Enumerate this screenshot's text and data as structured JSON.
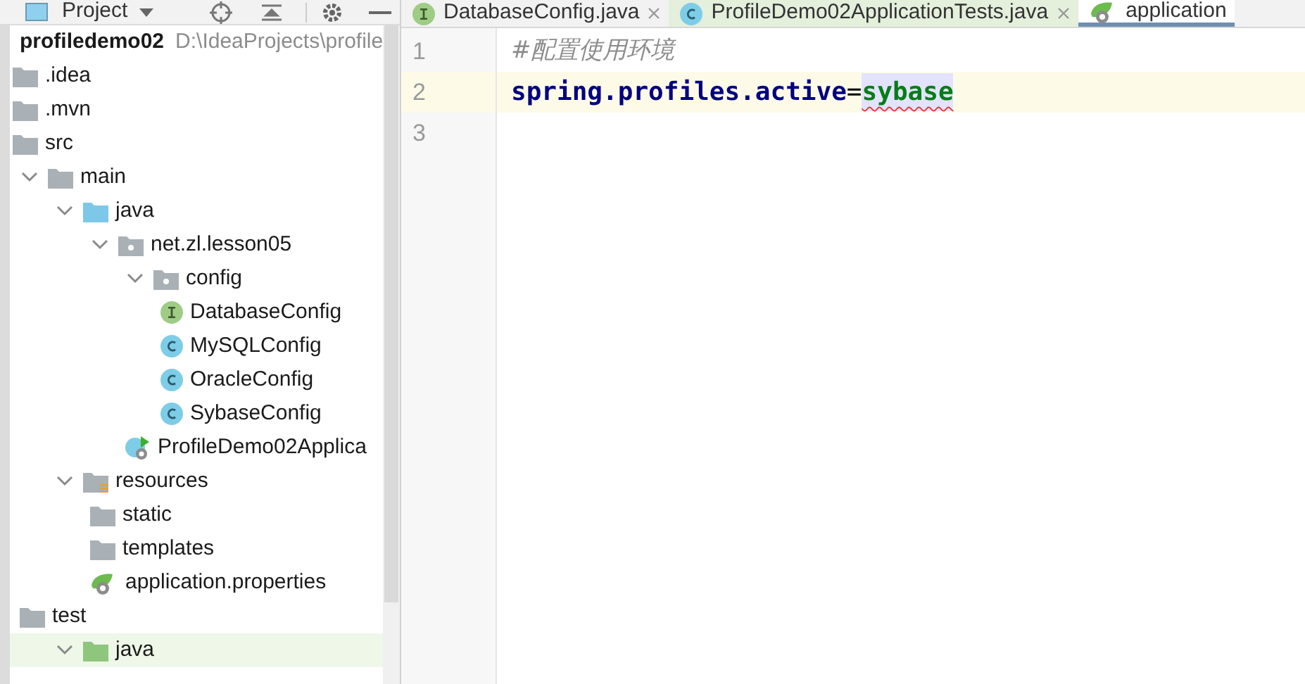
{
  "project_panel": {
    "title": "Project"
  },
  "tree": [
    {
      "name": "profiledemo02",
      "path": "D:\\IdeaProjects\\profile",
      "selected": false,
      "children": [
        {
          "name": ".idea",
          "kind": "folder",
          "selected": false
        },
        {
          "name": ".mvn",
          "kind": "folder",
          "selected": false
        },
        {
          "name": "src",
          "kind": "folder",
          "selected": false,
          "children": [
            {
              "name": "main",
              "kind": "folder",
              "expanded": true,
              "selected": false,
              "children": [
                {
                  "name": "java",
                  "kind": "source-folder",
                  "expanded": true,
                  "selected": false,
                  "children": [
                    {
                      "name": "net.zl.lesson05",
                      "kind": "package",
                      "expanded": true,
                      "selected": false,
                      "children": [
                        {
                          "name": "config",
                          "kind": "package",
                          "expanded": true,
                          "selected": false,
                          "children": [
                            {
                              "name": "DatabaseConfig",
                              "kind": "interface",
                              "selected": false
                            },
                            {
                              "name": "MySQLConfig",
                              "kind": "class",
                              "selected": false
                            },
                            {
                              "name": "OracleConfig",
                              "kind": "class",
                              "selected": false
                            },
                            {
                              "name": "SybaseConfig",
                              "kind": "class",
                              "selected": false
                            }
                          ]
                        },
                        {
                          "name": "ProfileDemo02Applica",
                          "kind": "spring-app",
                          "selected": false
                        }
                      ]
                    }
                  ]
                },
                {
                  "name": "resources",
                  "kind": "resources-folder",
                  "expanded": true,
                  "selected": false,
                  "children": [
                    {
                      "name": "static",
                      "kind": "folder",
                      "selected": false
                    },
                    {
                      "name": "templates",
                      "kind": "folder",
                      "selected": false
                    },
                    {
                      "name": "application.properties",
                      "kind": "spring-properties",
                      "selected": false
                    }
                  ]
                }
              ]
            },
            {
              "name": "test",
              "kind": "folder",
              "selected": false,
              "children": [
                {
                  "name": "java",
                  "kind": "test-folder",
                  "expanded": true,
                  "selected": true
                }
              ]
            }
          ]
        }
      ]
    }
  ],
  "tabs": [
    {
      "label": "DatabaseConfig.java",
      "kind": "interface",
      "selected": false
    },
    {
      "label": "ProfileDemo02ApplicationTests.java",
      "kind": "class",
      "selected": false
    },
    {
      "label": "application",
      "kind": "spring-properties",
      "selected": true
    }
  ],
  "editor": {
    "lines": [
      {
        "number": "1",
        "kind": "comment",
        "text": "#配置使用环境",
        "current": false
      },
      {
        "number": "2",
        "kind": "property",
        "key": "spring.profiles.active",
        "separator": "=",
        "value": "sybase",
        "value_highlighted": true,
        "value_flagged": true,
        "current": true
      },
      {
        "number": "3",
        "kind": "empty",
        "current": false
      }
    ]
  }
}
